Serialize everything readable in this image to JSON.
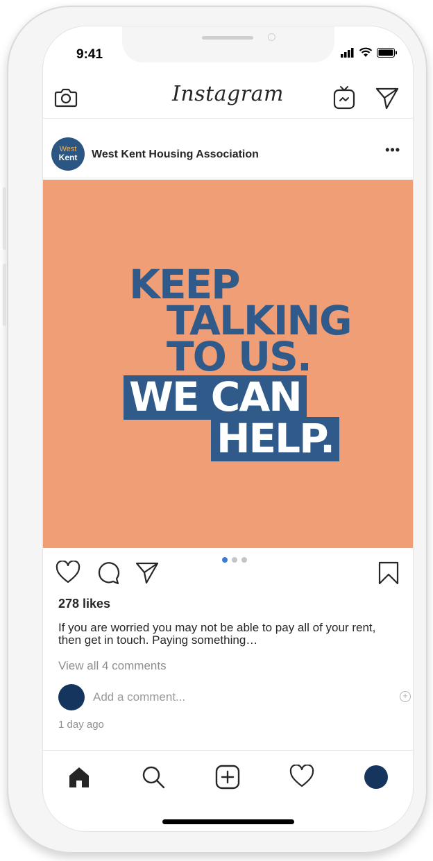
{
  "status_bar": {
    "time": "9:41"
  },
  "header": {
    "logo": "Instagram",
    "icons": [
      "camera-icon",
      "igtv-icon",
      "direct-message-icon"
    ]
  },
  "post": {
    "account": {
      "avatar_line1": "West",
      "avatar_line2": "Kent",
      "username": "West Kent Housing Association"
    },
    "more_label": "•••",
    "image_text": {
      "line1": "KEEP",
      "line2": "TALKING",
      "line3": "TO US.",
      "line4": "WE CAN",
      "line5": "HELP."
    },
    "carousel": {
      "count": 3,
      "active_index": 0
    },
    "likes": "278 likes",
    "caption": "If you are worried you may not be able to pay all of your rent, then get in touch. Paying something…",
    "view_comments": "View all 4 comments",
    "comment_placeholder": "Add a comment...",
    "add_symbol": "+",
    "timestamp": "1 day ago"
  },
  "colors": {
    "image_bg": "#ef9e76",
    "brand_blue": "#2f5a8a",
    "carousel_active": "#3a7bd5"
  },
  "tabbar": {
    "icons": [
      "home-icon",
      "search-icon",
      "new-post-icon",
      "activity-heart-icon",
      "profile-avatar"
    ]
  }
}
